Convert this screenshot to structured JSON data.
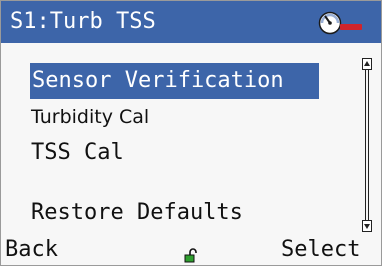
{
  "header": {
    "title": "S1:Turb TSS",
    "status_icon": "gauge-icon"
  },
  "menu": {
    "items": [
      {
        "label": "Sensor Verification",
        "selected": true
      },
      {
        "label": "Turbidity Cal",
        "selected": false
      },
      {
        "label": "TSS Cal",
        "selected": false
      },
      {
        "label": "Restore Defaults",
        "selected": false
      }
    ]
  },
  "softkeys": {
    "left_label": "Back",
    "right_label": "Select",
    "center_icon": "unlocked-padlock-icon"
  },
  "colors": {
    "accent": "#3d65a9",
    "background": "#f7f7f7",
    "text": "#111111",
    "status_red": "#d0242b",
    "lock_green": "#2e9e2e"
  }
}
